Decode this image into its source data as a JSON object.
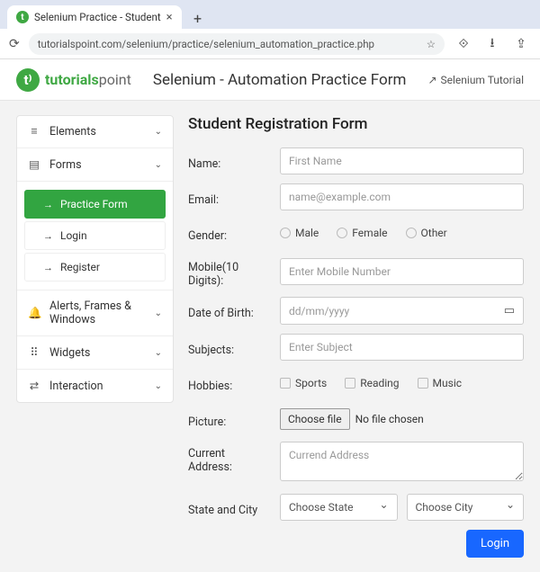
{
  "browser": {
    "tab_title": "Selenium Practice - Student",
    "url": "tutorialspoint.com/selenium/practice/selenium_automation_practice.php"
  },
  "logo": {
    "bold": "tutorials",
    "light": "point"
  },
  "header": {
    "title": "Selenium - Automation Practice Form",
    "tutorial_link": "Selenium Tutorial"
  },
  "sidebar": {
    "categories": [
      {
        "icon": "≡",
        "label": "Elements"
      },
      {
        "icon": "▤",
        "label": "Forms",
        "children": [
          {
            "label": "Practice Form",
            "active": true
          },
          {
            "label": "Login",
            "active": false
          },
          {
            "label": "Register",
            "active": false
          }
        ]
      },
      {
        "icon": "🔔",
        "label": "Alerts, Frames & Windows"
      },
      {
        "icon": "⠿",
        "label": "Widgets"
      },
      {
        "icon": "⇄",
        "label": "Interaction"
      }
    ]
  },
  "form": {
    "title": "Student Registration Form",
    "name": {
      "label": "Name:",
      "placeholder": "First Name"
    },
    "email": {
      "label": "Email:",
      "placeholder": "name@example.com"
    },
    "gender": {
      "label": "Gender:",
      "options": [
        "Male",
        "Female",
        "Other"
      ]
    },
    "mobile": {
      "label": "Mobile(10 Digits):",
      "placeholder": "Enter Mobile Number"
    },
    "dob": {
      "label": "Date of Birth:",
      "placeholder": "dd/mm/yyyy"
    },
    "subjects": {
      "label": "Subjects:",
      "placeholder": "Enter Subject"
    },
    "hobbies": {
      "label": "Hobbies:",
      "options": [
        "Sports",
        "Reading",
        "Music"
      ]
    },
    "picture": {
      "label": "Picture:",
      "button": "Choose file",
      "status": "No file chosen"
    },
    "address": {
      "label": "Current Address:",
      "placeholder": "Currend Address"
    },
    "location": {
      "label": "State and City",
      "state": "Choose State",
      "city": "Choose City"
    },
    "submit": "Login"
  }
}
